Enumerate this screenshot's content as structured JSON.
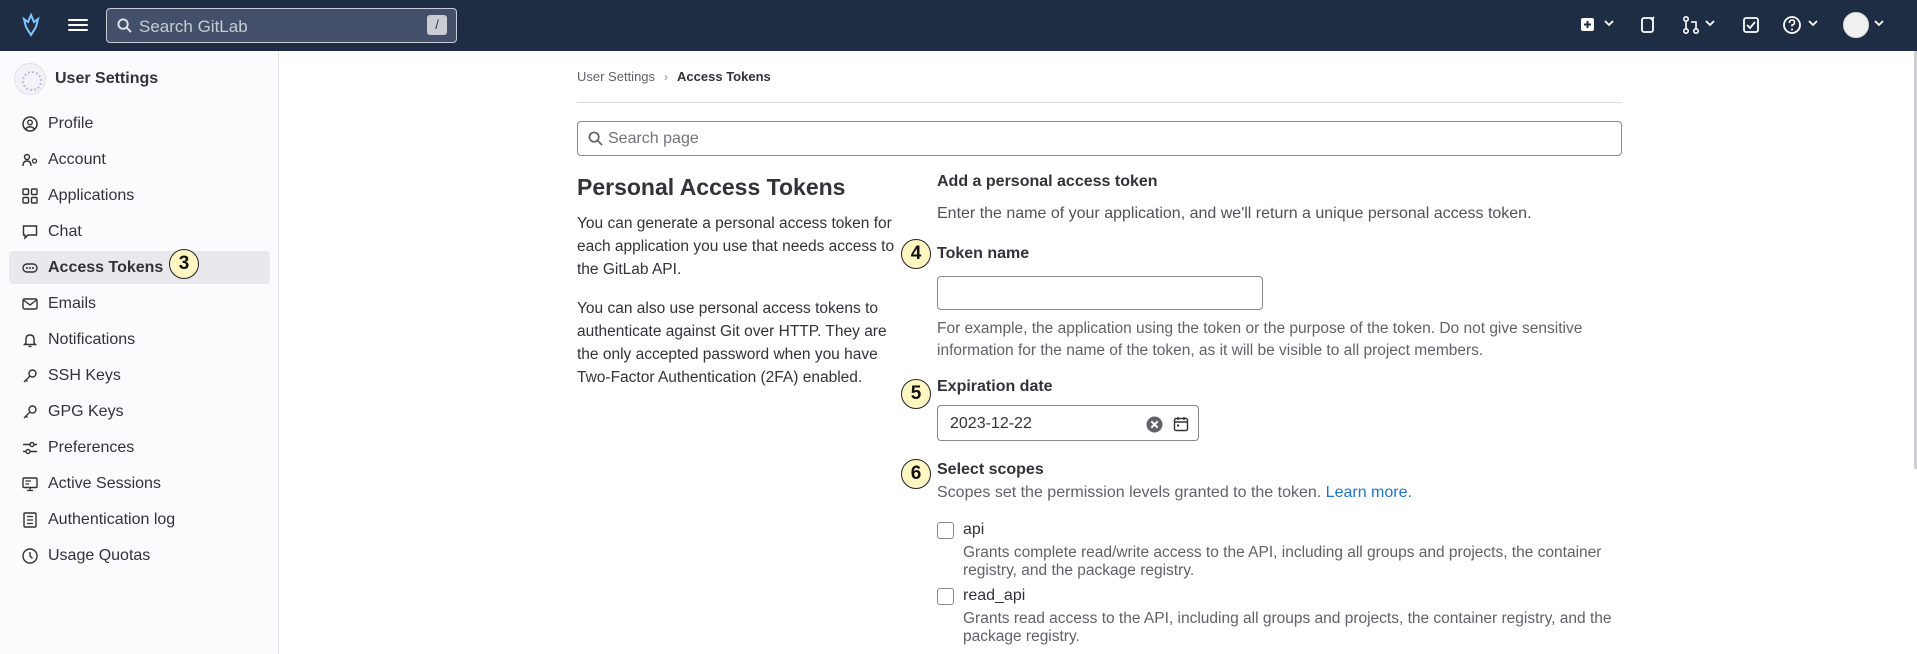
{
  "topbar": {
    "search_placeholder": "Search GitLab",
    "search_shortcut": "/",
    "icons": [
      "gitlab-logo-icon",
      "hamburger-menu-icon",
      "search-icon",
      "new-item-icon",
      "issues-icon",
      "merge-requests-icon",
      "todo-icon",
      "help-icon",
      "user-avatar"
    ]
  },
  "sidebar": {
    "title": "User Settings",
    "items": [
      {
        "label": "Profile",
        "icon": "profile-icon"
      },
      {
        "label": "Account",
        "icon": "account-icon"
      },
      {
        "label": "Applications",
        "icon": "applications-icon"
      },
      {
        "label": "Chat",
        "icon": "chat-icon"
      },
      {
        "label": "Access Tokens",
        "icon": "token-icon",
        "active": true
      },
      {
        "label": "Emails",
        "icon": "mail-icon"
      },
      {
        "label": "Notifications",
        "icon": "bell-icon"
      },
      {
        "label": "SSH Keys",
        "icon": "key-icon"
      },
      {
        "label": "GPG Keys",
        "icon": "key-icon"
      },
      {
        "label": "Preferences",
        "icon": "preferences-icon"
      },
      {
        "label": "Active Sessions",
        "icon": "monitor-icon"
      },
      {
        "label": "Authentication log",
        "icon": "log-icon"
      },
      {
        "label": "Usage Quotas",
        "icon": "quota-icon"
      }
    ]
  },
  "annotations": {
    "access_tokens": "3",
    "token_name": "4",
    "expiration": "5",
    "scopes": "6"
  },
  "breadcrumb": {
    "parent": "User Settings",
    "separator": "›",
    "current": "Access Tokens"
  },
  "page_search": {
    "placeholder": "Search page"
  },
  "intro": {
    "title": "Personal Access Tokens",
    "paragraph1": "You can generate a personal access token for each application you use that needs access to the GitLab API.",
    "paragraph2": "You can also use personal access tokens to authenticate against Git over HTTP. They are the only accepted password when you have Two-Factor Authentication (2FA) enabled."
  },
  "form": {
    "title": "Add a personal access token",
    "subtitle": "Enter the name of your application, and we'll return a unique personal access token.",
    "token_name_label": "Token name",
    "token_name_value": "",
    "token_name_help": "For example, the application using the token or the purpose of the token. Do not give sensitive information for the name of the token, as it will be visible to all project members.",
    "expiration_label": "Expiration date",
    "expiration_value": "2023-12-22",
    "scopes_label": "Select scopes",
    "scopes_help": "Scopes set the permission levels granted to the token.",
    "scopes_link": "Learn more.",
    "scopes": [
      {
        "name": "api",
        "checked": false,
        "description": "Grants complete read/write access to the API, including all groups and projects, the container registry, and the package registry."
      },
      {
        "name": "read_api",
        "checked": false,
        "description": "Grants read access to the API, including all groups and projects, the container registry, and the package registry."
      }
    ]
  },
  "colors": {
    "topbar": "#1f2d44",
    "link": "#1f75cb",
    "active_nav": "#e9e9ed",
    "annotation_fill": "#fff6c2"
  }
}
